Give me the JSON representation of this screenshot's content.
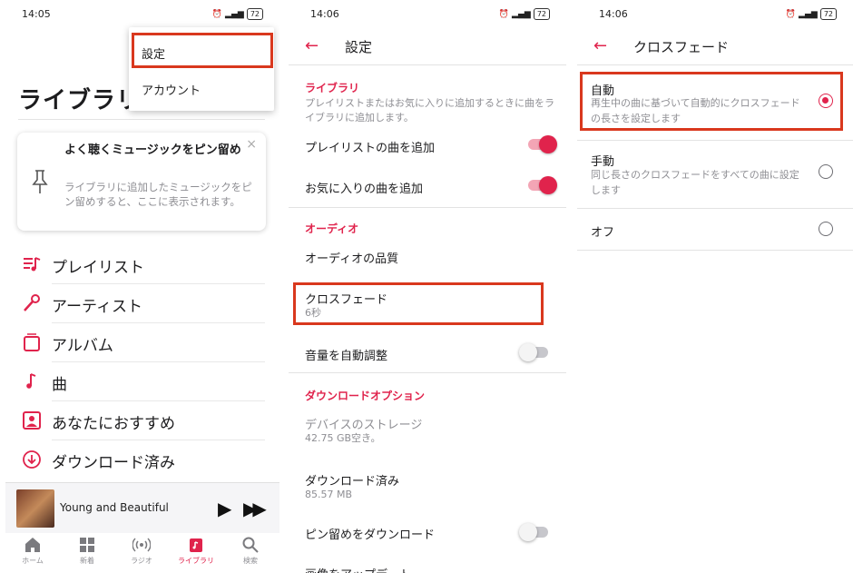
{
  "panel_library": {
    "time": "14:05",
    "battery": "72",
    "title": "ライブラリ",
    "menu": {
      "settings": "設定",
      "account": "アカウント"
    },
    "pin_card": {
      "title": "よく聴くミュージックをピン留め",
      "description": "ライブラリに追加したミュージックをピン留めすると、ここに表示されます。",
      "close": "×"
    },
    "items": [
      {
        "label": "プレイリスト"
      },
      {
        "label": "アーティスト"
      },
      {
        "label": "アルバム"
      },
      {
        "label": "曲"
      },
      {
        "label": "あなたにおすすめ"
      },
      {
        "label": "ダウンロード済み"
      }
    ],
    "now_playing": {
      "song": "Young and Beautiful"
    },
    "tabs": [
      {
        "label": "ホーム"
      },
      {
        "label": "新着"
      },
      {
        "label": "ラジオ"
      },
      {
        "label": "ライブラリ"
      },
      {
        "label": "検索"
      }
    ]
  },
  "panel_settings": {
    "time": "14:06",
    "battery": "72",
    "title": "設定",
    "library_section": "ライブラリ",
    "library_description": "プレイリストまたはお気に入りに追加するときに曲をライブラリに追加します。",
    "add_playlist_songs": "プレイリストの曲を追加",
    "add_favorite_songs": "お気に入りの曲を追加",
    "audio_section": "オーディオ",
    "audio_quality": "オーディオの品質",
    "crossfade": "クロスフェード",
    "crossfade_value": "6秒",
    "auto_volume": "音量を自動調整",
    "download_section": "ダウンロードオプション",
    "device_storage": "デバイスのストレージ",
    "device_storage_value": "42.75 GB空き。",
    "downloaded": "ダウンロード済み",
    "downloaded_value": "85.57 MB",
    "download_pinned": "ピン留めをダウンロード",
    "cutoff_row": "画像をアップデート"
  },
  "panel_crossfade": {
    "time": "14:06",
    "battery": "72",
    "title": "クロスフェード",
    "auto": "自動",
    "auto_description": "再生中の曲に基づいて自動的にクロスフェードの長さを設定します",
    "manual": "手動",
    "manual_description": "同じ長さのクロスフェードをすべての曲に設定します",
    "off": "オフ"
  },
  "colors": {
    "accent": "#e0234c",
    "highlight": "#d9381e"
  }
}
